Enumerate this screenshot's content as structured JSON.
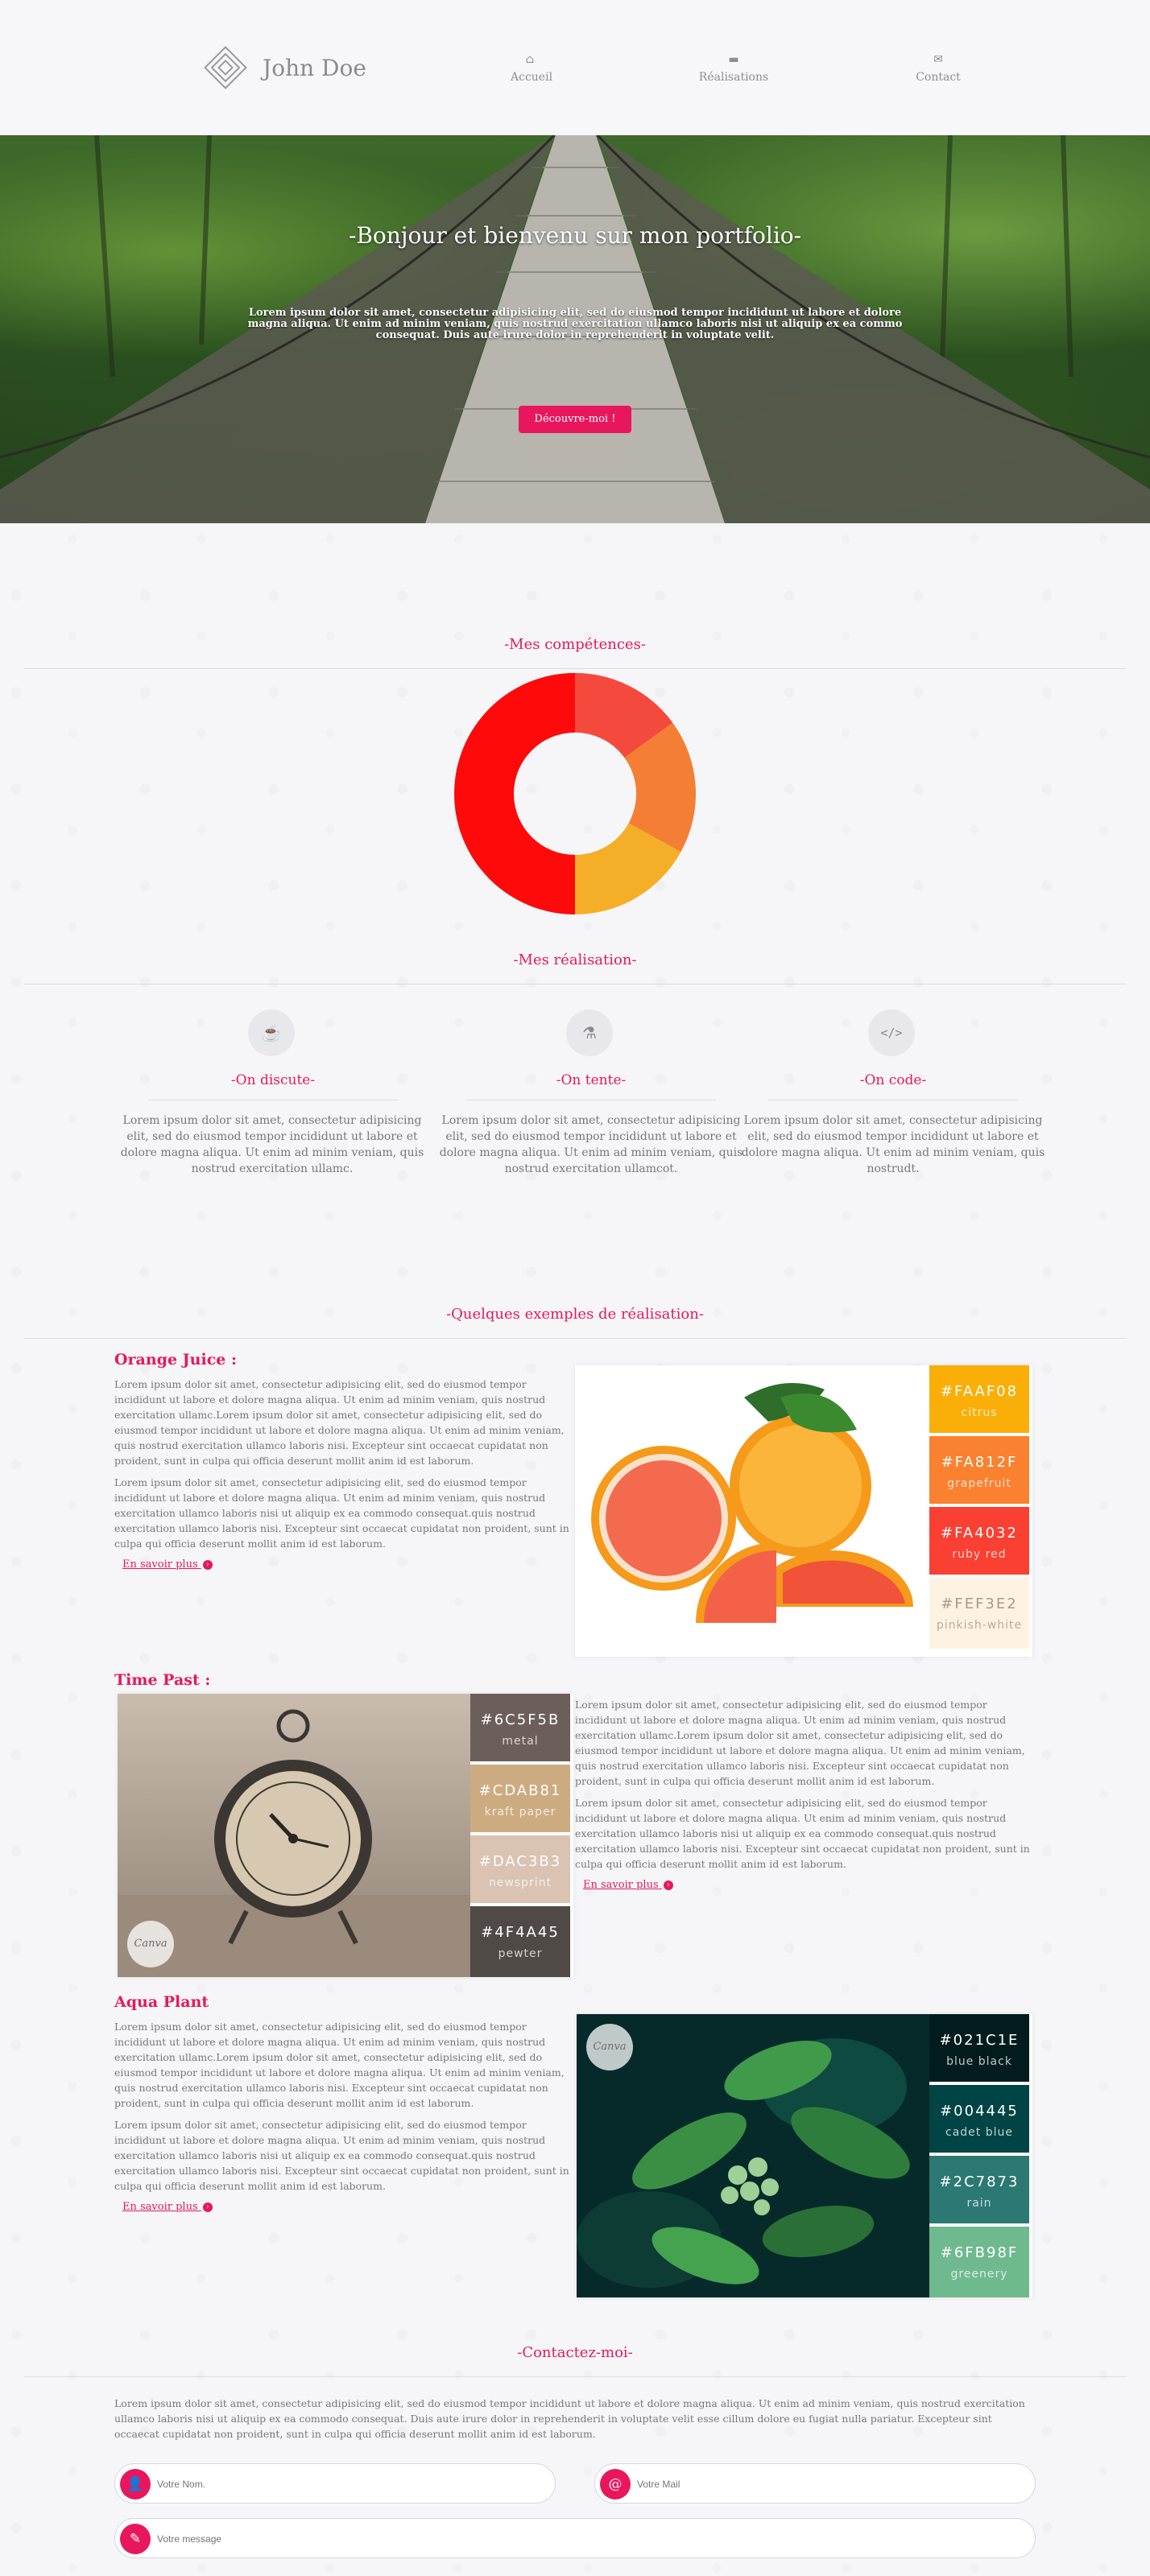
{
  "header": {
    "logo_name": "John Doe",
    "nav": [
      {
        "label": "Accueil",
        "icon": "home-icon"
      },
      {
        "label": "Réalisations",
        "icon": "folder-icon"
      },
      {
        "label": "Contact",
        "icon": "envelope-icon"
      }
    ]
  },
  "hero": {
    "title": "-Bonjour et bienvenu sur mon portfolio-",
    "text": "Lorem ipsum dolor sit amet, consectetur adipisicing elit, sed do eiusmod tempor incididunt ut labore et dolore magna aliqua. Ut enim ad minim veniam, quis nostrud exercitation ullamco laboris nisi ut aliquip ex ea commo consequat. Duis aute irure dolor in reprehenderit in voluptate velit.",
    "button_label": "Découvre-moi !"
  },
  "skills": {
    "title": "-Mes compétences-",
    "chart_data": {
      "type": "pie",
      "title": "",
      "values": [
        15,
        18,
        17,
        50
      ],
      "colors": [
        "#f44a3e",
        "#f57e35",
        "#f5ae28",
        "#fe0a0a"
      ]
    }
  },
  "realisations": {
    "title": "-Mes réalisation-",
    "columns": [
      {
        "icon": "coffee-icon",
        "title": "-On discute-",
        "text": "Lorem ipsum dolor sit amet, consectetur adipisicing elit, sed do eiusmod tempor incididunt ut labore et dolore magna aliqua. Ut enim ad minim veniam, quis nostrud exercitation ullamc."
      },
      {
        "icon": "flask-icon",
        "title": "-On tente-",
        "text": "Lorem ipsum dolor sit amet, consectetur adipisicing elit, sed do eiusmod tempor incididunt ut labore et dolore magna aliqua. Ut enim ad minim veniam, quis nostrud exercitation ullamcot."
      },
      {
        "icon": "code-icon",
        "title": "-On code-",
        "text": "Lorem ipsum dolor sit amet, consectetur adipisicing elit, sed do eiusmod tempor incididunt ut labore et dolore magna aliqua. Ut enim ad minim veniam, quis nostrudt."
      }
    ]
  },
  "examples": {
    "title": "-Quelques exemples de réalisation-",
    "p1": "Lorem ipsum dolor sit amet, consectetur adipisicing elit, sed do eiusmod tempor incididunt ut labore et dolore magna aliqua. Ut enim ad minim veniam, quis nostrud exercitation ullamc.Lorem ipsum dolor sit amet, consectetur adipisicing elit, sed do eiusmod tempor incididunt ut labore et dolore magna aliqua. Ut enim ad minim veniam, quis nostrud exercitation ullamco laboris nisi. Excepteur sint occaecat cupidatat non proident, sunt in culpa qui officia deserunt mollit anim id est laborum.",
    "p2": "Lorem ipsum dolor sit amet, consectetur adipisicing elit, sed do eiusmod tempor incididunt ut labore et dolore magna aliqua. Ut enim ad minim veniam, quis nostrud exercitation ullamco laboris nisi ut aliquip ex ea commodo consequat.quis nostrud exercitation ullamco laboris nisi. Excepteur sint occaecat cupidatat non proident, sunt in culpa qui officia deserunt mollit anim id est laborum.",
    "link_label": "En savoir plus",
    "badge": "Canva",
    "items": [
      {
        "title": "Orange Juice :",
        "swatches": [
          {
            "hex": "#FAAF08",
            "name": "citrus"
          },
          {
            "hex": "#FA812F",
            "name": "grapefruit"
          },
          {
            "hex": "#FA4032",
            "name": "ruby red"
          },
          {
            "hex": "#FEF3E2",
            "name": "pinkish-white"
          }
        ]
      },
      {
        "title": "Time Past :",
        "swatches": [
          {
            "hex": "#6C5F5B",
            "name": "metal"
          },
          {
            "hex": "#CDAB81",
            "name": "kraft paper"
          },
          {
            "hex": "#DAC3B3",
            "name": "newsprint"
          },
          {
            "hex": "#4F4A45",
            "name": "pewter"
          }
        ]
      },
      {
        "title": "Aqua Plant",
        "swatches": [
          {
            "hex": "#021C1E",
            "name": "blue black"
          },
          {
            "hex": "#004445",
            "name": "cadet blue"
          },
          {
            "hex": "#2C7873",
            "name": "rain"
          },
          {
            "hex": "#6FB98F",
            "name": "greenery"
          }
        ]
      }
    ]
  },
  "contact": {
    "title": "-Contactez-moi-",
    "text": "Lorem ipsum dolor sit amet, consectetur adipisicing elit, sed do eiusmod tempor incididunt ut labore et dolore magna aliqua. Ut enim ad minim veniam, quis nostrud exercitation ullamco laboris nisi ut aliquip ex ea commodo consequat. Duis aute irure dolor in reprehenderit in voluptate velit esse cillum dolore eu fugiat nulla pariatur. Excepteur sint occaecat cupidatat non proident, sunt in culpa qui officia deserunt mollit anim id est laborum.",
    "name_placeholder": "Votre Nom.",
    "mail_placeholder": "Votre Mail",
    "message_placeholder": "Votre message"
  }
}
